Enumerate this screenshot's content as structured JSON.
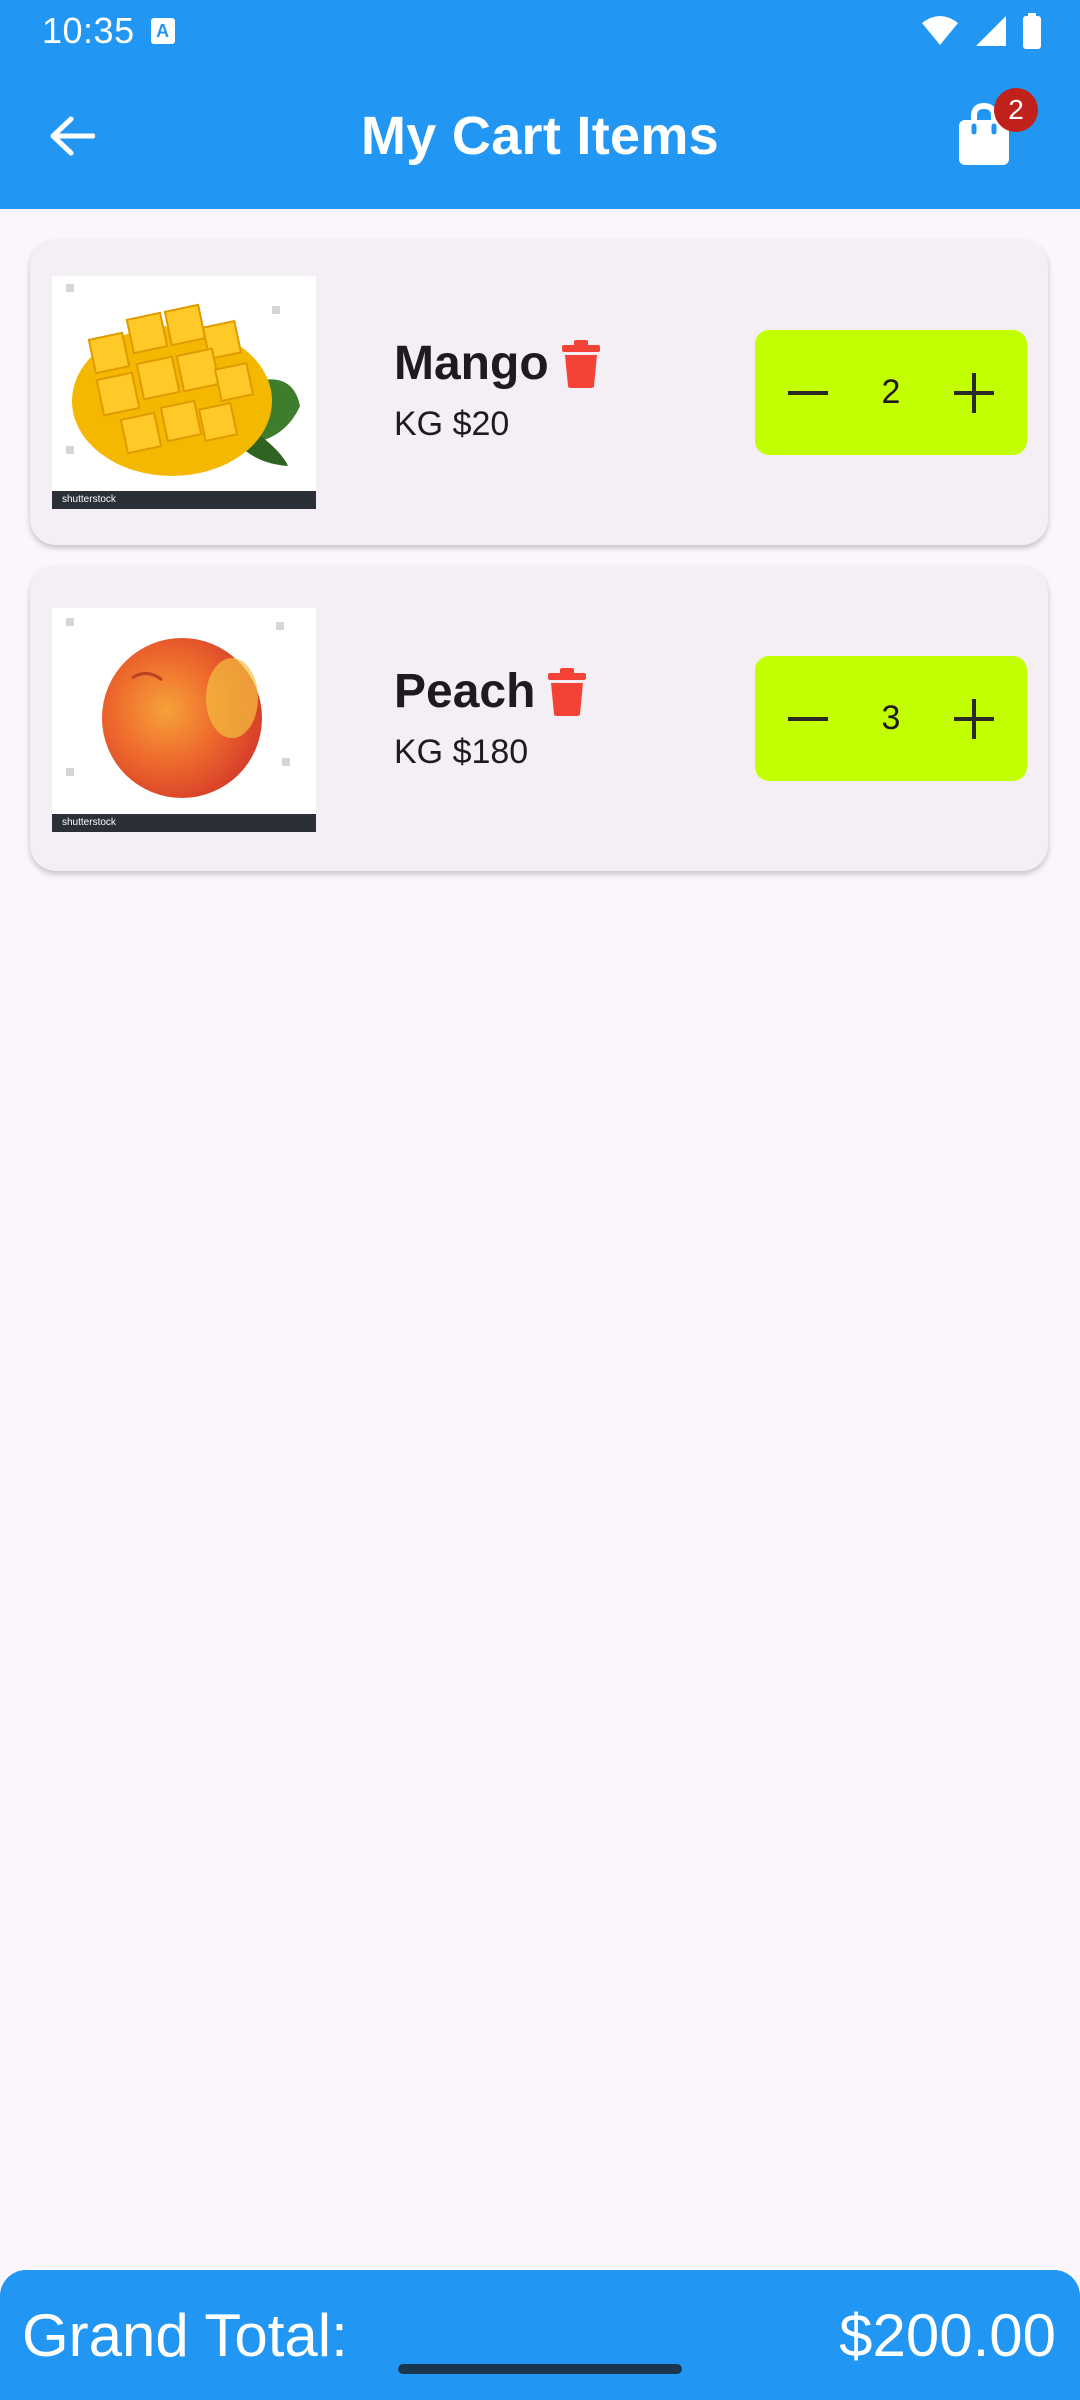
{
  "status": {
    "time": "10:35",
    "notification_icon": "A"
  },
  "appbar": {
    "title": "My Cart Items",
    "cart_badge": "2"
  },
  "items": [
    {
      "name": "Mango",
      "price": "KG $20",
      "quantity": "2",
      "watermark": "shutterstock"
    },
    {
      "name": "Peach",
      "price": "KG $180",
      "quantity": "3",
      "watermark": "shutterstock"
    }
  ],
  "footer": {
    "label": "Grand Total:",
    "total": "$200.00"
  },
  "colors": {
    "appbar": "#2196F3",
    "stepper": "#C2FF00",
    "trash": "#F44336",
    "badge": "#C0211B",
    "background": "#FCF6FC"
  },
  "icons": [
    "back-arrow-icon",
    "shopping-bag-icon",
    "trash-icon",
    "minus-icon",
    "plus-icon",
    "wifi-icon",
    "signal-icon",
    "battery-icon"
  ]
}
